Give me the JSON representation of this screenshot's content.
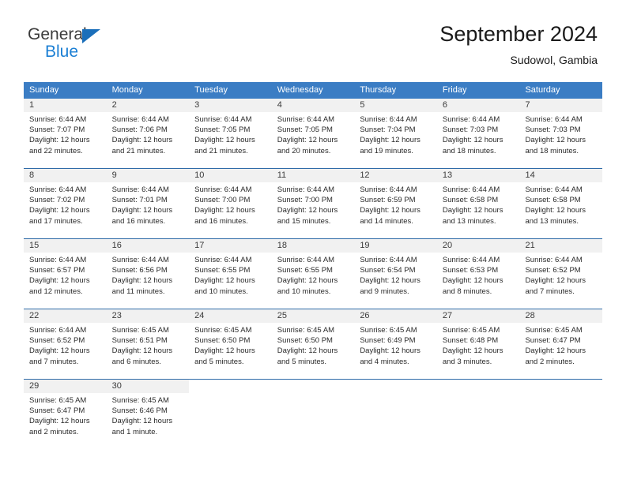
{
  "brand": {
    "name_part1": "General",
    "name_part2": "Blue",
    "triangle_icon": "triangle-icon",
    "color_dark": "#3c3c3c",
    "color_blue": "#1b7fd4"
  },
  "header": {
    "title": "September 2024",
    "subtitle": "Sudowol, Gambia"
  },
  "calendar": {
    "header_bg": "#3b7dc4",
    "daynum_bg": "#f1f1f1",
    "day_names": [
      "Sunday",
      "Monday",
      "Tuesday",
      "Wednesday",
      "Thursday",
      "Friday",
      "Saturday"
    ],
    "weeks": [
      [
        {
          "day": "1",
          "sunrise": "Sunrise: 6:44 AM",
          "sunset": "Sunset: 7:07 PM",
          "daylight1": "Daylight: 12 hours",
          "daylight2": "and 22 minutes."
        },
        {
          "day": "2",
          "sunrise": "Sunrise: 6:44 AM",
          "sunset": "Sunset: 7:06 PM",
          "daylight1": "Daylight: 12 hours",
          "daylight2": "and 21 minutes."
        },
        {
          "day": "3",
          "sunrise": "Sunrise: 6:44 AM",
          "sunset": "Sunset: 7:05 PM",
          "daylight1": "Daylight: 12 hours",
          "daylight2": "and 21 minutes."
        },
        {
          "day": "4",
          "sunrise": "Sunrise: 6:44 AM",
          "sunset": "Sunset: 7:05 PM",
          "daylight1": "Daylight: 12 hours",
          "daylight2": "and 20 minutes."
        },
        {
          "day": "5",
          "sunrise": "Sunrise: 6:44 AM",
          "sunset": "Sunset: 7:04 PM",
          "daylight1": "Daylight: 12 hours",
          "daylight2": "and 19 minutes."
        },
        {
          "day": "6",
          "sunrise": "Sunrise: 6:44 AM",
          "sunset": "Sunset: 7:03 PM",
          "daylight1": "Daylight: 12 hours",
          "daylight2": "and 18 minutes."
        },
        {
          "day": "7",
          "sunrise": "Sunrise: 6:44 AM",
          "sunset": "Sunset: 7:03 PM",
          "daylight1": "Daylight: 12 hours",
          "daylight2": "and 18 minutes."
        }
      ],
      [
        {
          "day": "8",
          "sunrise": "Sunrise: 6:44 AM",
          "sunset": "Sunset: 7:02 PM",
          "daylight1": "Daylight: 12 hours",
          "daylight2": "and 17 minutes."
        },
        {
          "day": "9",
          "sunrise": "Sunrise: 6:44 AM",
          "sunset": "Sunset: 7:01 PM",
          "daylight1": "Daylight: 12 hours",
          "daylight2": "and 16 minutes."
        },
        {
          "day": "10",
          "sunrise": "Sunrise: 6:44 AM",
          "sunset": "Sunset: 7:00 PM",
          "daylight1": "Daylight: 12 hours",
          "daylight2": "and 16 minutes."
        },
        {
          "day": "11",
          "sunrise": "Sunrise: 6:44 AM",
          "sunset": "Sunset: 7:00 PM",
          "daylight1": "Daylight: 12 hours",
          "daylight2": "and 15 minutes."
        },
        {
          "day": "12",
          "sunrise": "Sunrise: 6:44 AM",
          "sunset": "Sunset: 6:59 PM",
          "daylight1": "Daylight: 12 hours",
          "daylight2": "and 14 minutes."
        },
        {
          "day": "13",
          "sunrise": "Sunrise: 6:44 AM",
          "sunset": "Sunset: 6:58 PM",
          "daylight1": "Daylight: 12 hours",
          "daylight2": "and 13 minutes."
        },
        {
          "day": "14",
          "sunrise": "Sunrise: 6:44 AM",
          "sunset": "Sunset: 6:58 PM",
          "daylight1": "Daylight: 12 hours",
          "daylight2": "and 13 minutes."
        }
      ],
      [
        {
          "day": "15",
          "sunrise": "Sunrise: 6:44 AM",
          "sunset": "Sunset: 6:57 PM",
          "daylight1": "Daylight: 12 hours",
          "daylight2": "and 12 minutes."
        },
        {
          "day": "16",
          "sunrise": "Sunrise: 6:44 AM",
          "sunset": "Sunset: 6:56 PM",
          "daylight1": "Daylight: 12 hours",
          "daylight2": "and 11 minutes."
        },
        {
          "day": "17",
          "sunrise": "Sunrise: 6:44 AM",
          "sunset": "Sunset: 6:55 PM",
          "daylight1": "Daylight: 12 hours",
          "daylight2": "and 10 minutes."
        },
        {
          "day": "18",
          "sunrise": "Sunrise: 6:44 AM",
          "sunset": "Sunset: 6:55 PM",
          "daylight1": "Daylight: 12 hours",
          "daylight2": "and 10 minutes."
        },
        {
          "day": "19",
          "sunrise": "Sunrise: 6:44 AM",
          "sunset": "Sunset: 6:54 PM",
          "daylight1": "Daylight: 12 hours",
          "daylight2": "and 9 minutes."
        },
        {
          "day": "20",
          "sunrise": "Sunrise: 6:44 AM",
          "sunset": "Sunset: 6:53 PM",
          "daylight1": "Daylight: 12 hours",
          "daylight2": "and 8 minutes."
        },
        {
          "day": "21",
          "sunrise": "Sunrise: 6:44 AM",
          "sunset": "Sunset: 6:52 PM",
          "daylight1": "Daylight: 12 hours",
          "daylight2": "and 7 minutes."
        }
      ],
      [
        {
          "day": "22",
          "sunrise": "Sunrise: 6:44 AM",
          "sunset": "Sunset: 6:52 PM",
          "daylight1": "Daylight: 12 hours",
          "daylight2": "and 7 minutes."
        },
        {
          "day": "23",
          "sunrise": "Sunrise: 6:45 AM",
          "sunset": "Sunset: 6:51 PM",
          "daylight1": "Daylight: 12 hours",
          "daylight2": "and 6 minutes."
        },
        {
          "day": "24",
          "sunrise": "Sunrise: 6:45 AM",
          "sunset": "Sunset: 6:50 PM",
          "daylight1": "Daylight: 12 hours",
          "daylight2": "and 5 minutes."
        },
        {
          "day": "25",
          "sunrise": "Sunrise: 6:45 AM",
          "sunset": "Sunset: 6:50 PM",
          "daylight1": "Daylight: 12 hours",
          "daylight2": "and 5 minutes."
        },
        {
          "day": "26",
          "sunrise": "Sunrise: 6:45 AM",
          "sunset": "Sunset: 6:49 PM",
          "daylight1": "Daylight: 12 hours",
          "daylight2": "and 4 minutes."
        },
        {
          "day": "27",
          "sunrise": "Sunrise: 6:45 AM",
          "sunset": "Sunset: 6:48 PM",
          "daylight1": "Daylight: 12 hours",
          "daylight2": "and 3 minutes."
        },
        {
          "day": "28",
          "sunrise": "Sunrise: 6:45 AM",
          "sunset": "Sunset: 6:47 PM",
          "daylight1": "Daylight: 12 hours",
          "daylight2": "and 2 minutes."
        }
      ],
      [
        {
          "day": "29",
          "sunrise": "Sunrise: 6:45 AM",
          "sunset": "Sunset: 6:47 PM",
          "daylight1": "Daylight: 12 hours",
          "daylight2": "and 2 minutes."
        },
        {
          "day": "30",
          "sunrise": "Sunrise: 6:45 AM",
          "sunset": "Sunset: 6:46 PM",
          "daylight1": "Daylight: 12 hours",
          "daylight2": "and 1 minute."
        },
        {
          "day": "",
          "sunrise": "",
          "sunset": "",
          "daylight1": "",
          "daylight2": ""
        },
        {
          "day": "",
          "sunrise": "",
          "sunset": "",
          "daylight1": "",
          "daylight2": ""
        },
        {
          "day": "",
          "sunrise": "",
          "sunset": "",
          "daylight1": "",
          "daylight2": ""
        },
        {
          "day": "",
          "sunrise": "",
          "sunset": "",
          "daylight1": "",
          "daylight2": ""
        },
        {
          "day": "",
          "sunrise": "",
          "sunset": "",
          "daylight1": "",
          "daylight2": ""
        }
      ]
    ]
  }
}
